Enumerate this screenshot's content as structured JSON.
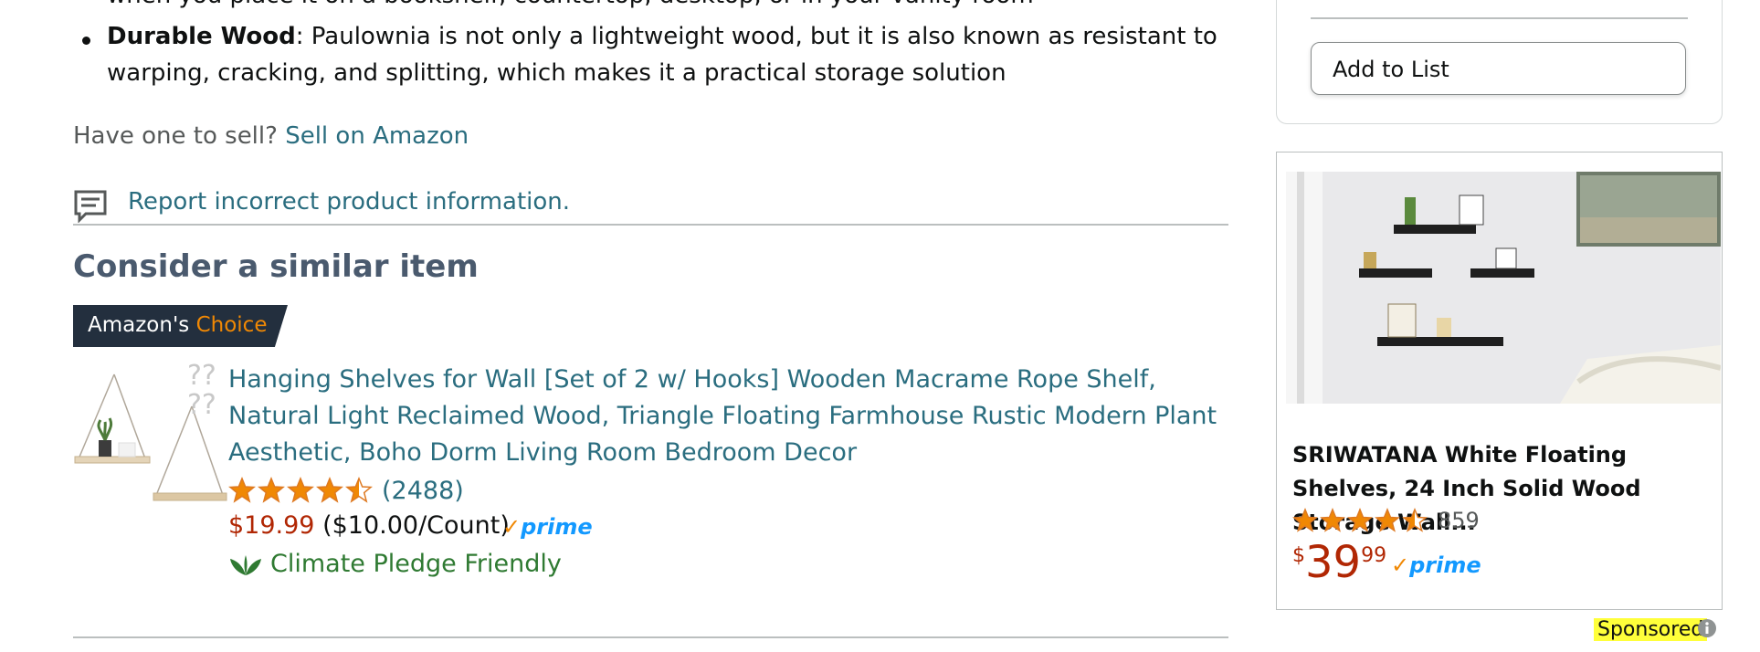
{
  "description_partial": "when you place it on a bookshelf, countertop, desktop, or in your vanity room",
  "bullet": {
    "bold": "Durable Wood",
    "text": ": Paulownia is not only a lightweight wood, but it is also known as resistant to warping, cracking, and splitting, which makes it a practical storage solution"
  },
  "sell": {
    "prefix": "Have one to sell?",
    "link": "Sell on Amazon"
  },
  "report": {
    "label": "Report incorrect product information.",
    "icon": "feedback-icon"
  },
  "similar": {
    "title": "Consider a similar item",
    "badge_prefix": "Amazon's",
    "badge_highlight": "Choice",
    "product_title": "Hanging Shelves for Wall [Set of 2 w/ Hooks] Wooden Macrame Rope Shelf, Natural Light Reclaimed Wood, Triangle Floating Farmhouse Rustic Modern Plant Aesthetic, Boho Dorm Living Room Bedroom Decor",
    "rating_stars": 4.5,
    "rating_count": "(2488)",
    "price": "$19.99",
    "unit_price": "($10.00/Count)",
    "prime": "prime",
    "climate": "Climate Pledge Friendly"
  },
  "sidebar": {
    "add_to_list": "Add to List"
  },
  "ad": {
    "title": "SRIWATANA White Floating Shelves, 24 Inch Solid Wood Storage Wall...",
    "rating_stars": 4.5,
    "rating_count": "859",
    "price_symbol": "$",
    "price_whole": "39",
    "price_fraction": "99",
    "prime": "prime",
    "sponsored": "Sponsored"
  },
  "colors": {
    "link": "#2a6d7f",
    "price": "#b12704",
    "star": "#f08804",
    "prime": "#1399ff",
    "climate": "#2f7a32",
    "highlight": "#ffff3a"
  }
}
